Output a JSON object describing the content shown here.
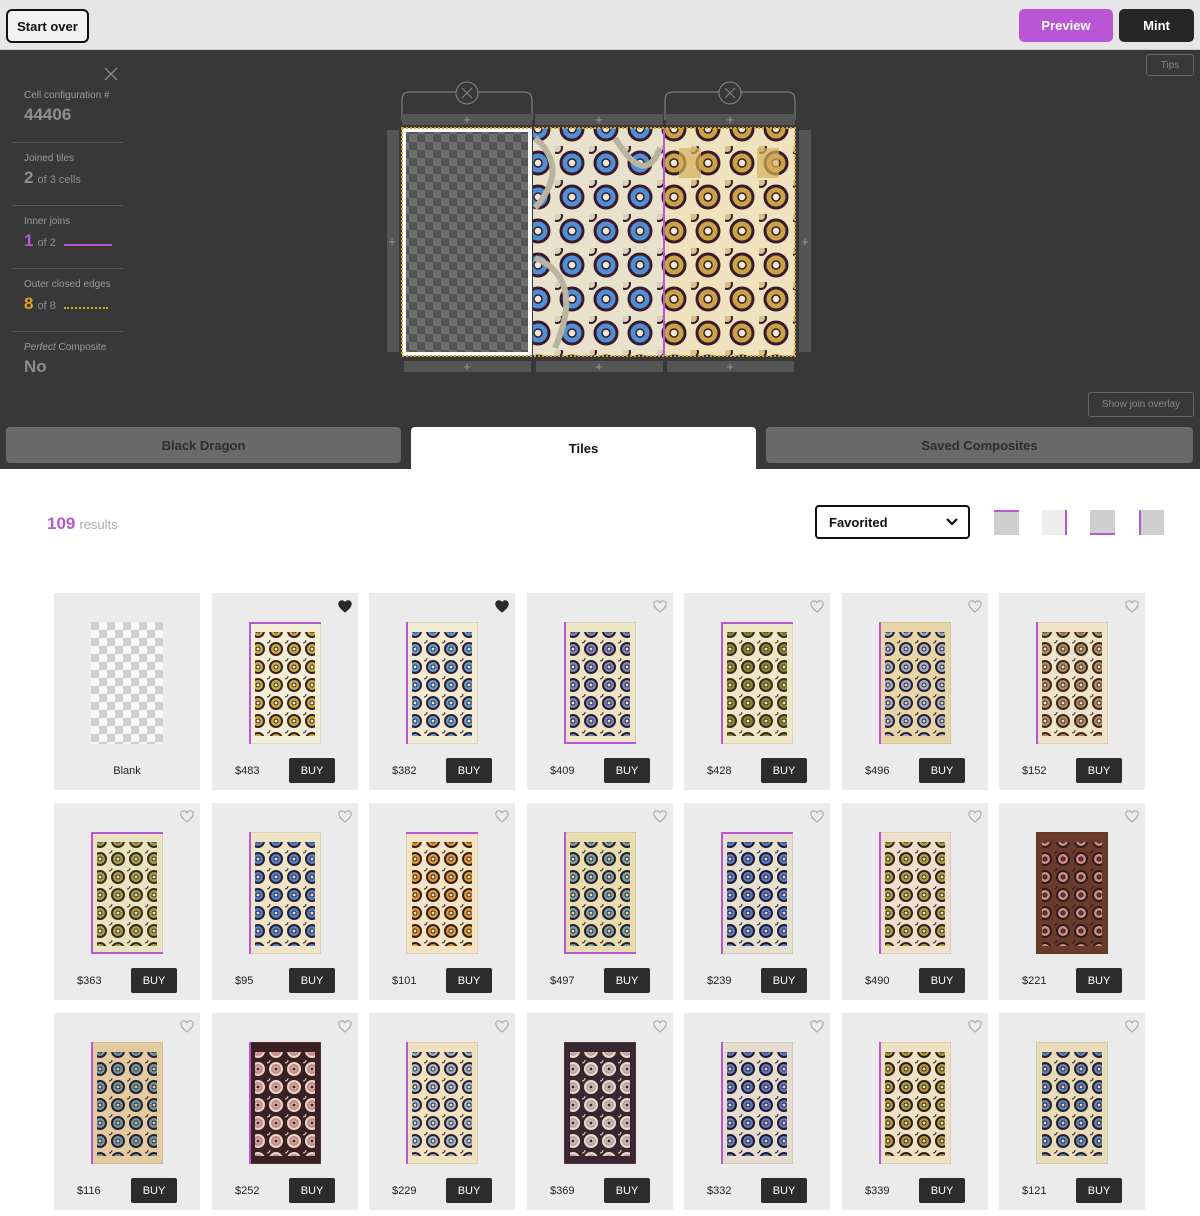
{
  "toolbar": {
    "start_over": "Start over",
    "preview": "Preview",
    "mint": "Mint",
    "accent": "#b856d6",
    "dark": "#262626"
  },
  "stats": {
    "config_label": "Cell configuration #",
    "config_value": "44406",
    "joined_label": "Joined tiles",
    "joined_value": "2",
    "joined_of": "of 3 cells",
    "inner_label": "Inner joins",
    "inner_value": "1",
    "inner_of": "of 2",
    "outer_label": "Outer closed edges",
    "outer_value": "8",
    "outer_of": "of 8",
    "perfect_label_em": "Perfect",
    "perfect_label_rest": " Composite",
    "perfect_value": "No"
  },
  "workspace": {
    "tips": "Tips",
    "show_join_overlay": "Show join overlay"
  },
  "tabs": [
    {
      "label": "Black Dragon",
      "active": false
    },
    {
      "label": "Tiles",
      "active": true
    },
    {
      "label": "Saved Composites",
      "active": false
    }
  ],
  "results": {
    "count": "109",
    "label": "results"
  },
  "filter": {
    "selected": "Favorited"
  },
  "tiles": [
    {
      "blank": true,
      "label": "Blank"
    },
    {
      "price": "$483",
      "buy": "BUY",
      "fav": true,
      "colors": [
        "#c7b33a",
        "#f3efd6",
        "#3a1a24"
      ],
      "edge": "top-left"
    },
    {
      "price": "$382",
      "buy": "BUY",
      "fav": true,
      "colors": [
        "#5aa0d8",
        "#f1ead4",
        "#3a1a24"
      ],
      "edge": "left"
    },
    {
      "price": "$409",
      "buy": "BUY",
      "fav": false,
      "colors": [
        "#7a86c0",
        "#ede4c6",
        "#2a1d2e"
      ],
      "edge": "left-bottom"
    },
    {
      "price": "$428",
      "buy": "BUY",
      "fav": false,
      "colors": [
        "#8a8a30",
        "#efe8c8",
        "#3a2a1c"
      ],
      "edge": "top-left"
    },
    {
      "price": "$496",
      "buy": "BUY",
      "fav": false,
      "colors": [
        "#9fb3cf",
        "#e6d6a8",
        "#2a1d2e"
      ],
      "edge": "left"
    },
    {
      "price": "$152",
      "buy": "BUY",
      "fav": false,
      "colors": [
        "#b28a64",
        "#efe3cc",
        "#3a2a1c"
      ],
      "edge": "left"
    },
    {
      "price": "$363",
      "buy": "BUY",
      "fav": false,
      "colors": [
        "#a6a04a",
        "#e8e4c0",
        "#3a2a1c"
      ],
      "edge": "all"
    },
    {
      "price": "$95",
      "buy": "BUY",
      "fav": false,
      "colors": [
        "#4f82d0",
        "#efe4c8",
        "#2a1d2e"
      ],
      "edge": "left"
    },
    {
      "price": "$101",
      "buy": "BUY",
      "fav": false,
      "colors": [
        "#d99a3a",
        "#f2e4c4",
        "#3a1a14"
      ],
      "edge": "top"
    },
    {
      "price": "$497",
      "buy": "BUY",
      "fav": false,
      "colors": [
        "#7aa6a6",
        "#e9dcae",
        "#2a1d2e"
      ],
      "edge": "left-bottom"
    },
    {
      "price": "$239",
      "buy": "BUY",
      "fav": false,
      "colors": [
        "#5c7ac8",
        "#e6e0d0",
        "#1e1a2e"
      ],
      "edge": "top-left"
    },
    {
      "price": "$490",
      "buy": "BUY",
      "fav": false,
      "colors": [
        "#a8a83a",
        "#efe0cc",
        "#3a1a24"
      ],
      "edge": "left"
    },
    {
      "price": "$221",
      "buy": "BUY",
      "fav": false,
      "colors": [
        "#d28a8a",
        "#6a3a2a",
        "#2a1d1a"
      ],
      "edge": "none"
    },
    {
      "price": "$116",
      "buy": "BUY",
      "fav": false,
      "colors": [
        "#6f98a4",
        "#e4caa0",
        "#2a1d2e"
      ],
      "edge": "left"
    },
    {
      "price": "$252",
      "buy": "BUY",
      "fav": false,
      "colors": [
        "#c98a86",
        "#3a2024",
        "#e9d6c4"
      ],
      "edge": "left"
    },
    {
      "price": "$229",
      "buy": "BUY",
      "fav": false,
      "colors": [
        "#9fb6c8",
        "#f0e2c0",
        "#2a1d2e"
      ],
      "edge": "left"
    },
    {
      "price": "$369",
      "buy": "BUY",
      "fav": false,
      "colors": [
        "#c2a2a6",
        "#3a2630",
        "#e8dcc8"
      ],
      "edge": "none"
    },
    {
      "price": "$332",
      "buy": "BUY",
      "fav": false,
      "colors": [
        "#6478c0",
        "#e6ddd0",
        "#1e1a2e"
      ],
      "edge": "left"
    },
    {
      "price": "$339",
      "buy": "BUY",
      "fav": false,
      "colors": [
        "#b39a3a",
        "#efe2c4",
        "#2a1d1a"
      ],
      "edge": "left"
    },
    {
      "price": "$121",
      "buy": "BUY",
      "fav": false,
      "colors": [
        "#5f84b6",
        "#e9dcb8",
        "#2a1d2e"
      ],
      "edge": "none"
    }
  ]
}
